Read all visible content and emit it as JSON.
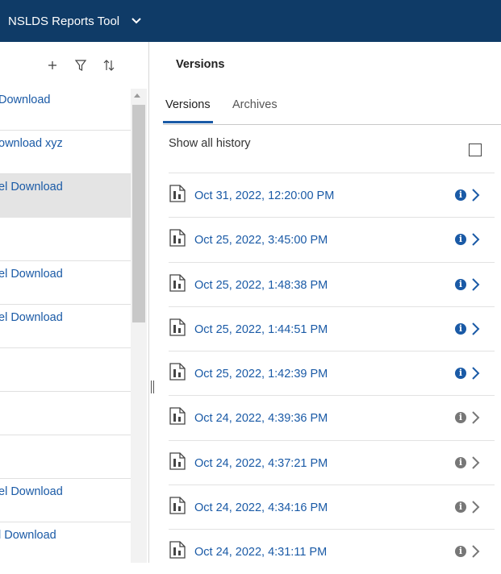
{
  "header": {
    "app_title": "NSLDS Reports Tool",
    "title_icon": "chevron-down-icon",
    "background_color": "#0f3b67"
  },
  "left_panel": {
    "toolbar": {
      "add_icon": "plus-icon",
      "filter_icon": "filter-icon",
      "sort_icon": "sort-icon"
    },
    "items": [
      {
        "label": "Download"
      },
      {
        "label": "ownload xyz"
      },
      {
        "label": "el Download",
        "selected": true
      },
      {
        "label": ""
      },
      {
        "label": "el Download"
      },
      {
        "label": "el Download"
      },
      {
        "label": ""
      },
      {
        "label": ""
      },
      {
        "label": ""
      },
      {
        "label": "el Download"
      },
      {
        "label": "l Download"
      }
    ]
  },
  "right_panel": {
    "title": "Versions",
    "tabs": [
      {
        "label": "Versions",
        "active": true
      },
      {
        "label": "Archives",
        "active": false
      }
    ],
    "show_all_history_label": "Show all history",
    "show_all_history_checked": false,
    "versions": [
      {
        "date": "Oct 31, 2022, 12:20:00 PM",
        "status": "active"
      },
      {
        "date": "Oct 25, 2022, 3:45:00 PM",
        "status": "active"
      },
      {
        "date": "Oct 25, 2022, 1:48:38 PM",
        "status": "active"
      },
      {
        "date": "Oct 25, 2022, 1:44:51 PM",
        "status": "active"
      },
      {
        "date": "Oct 25, 2022, 1:42:39 PM",
        "status": "active"
      },
      {
        "date": "Oct 24, 2022, 4:39:36 PM",
        "status": "inactive"
      },
      {
        "date": "Oct 24, 2022, 4:37:21 PM",
        "status": "inactive"
      },
      {
        "date": "Oct 24, 2022, 4:34:16 PM",
        "status": "inactive"
      },
      {
        "date": "Oct 24, 2022, 4:31:11 PM",
        "status": "inactive"
      }
    ],
    "colors": {
      "link": "#1a5aa6",
      "active_icon": "#1a5aa6",
      "inactive_icon": "#777777"
    }
  }
}
